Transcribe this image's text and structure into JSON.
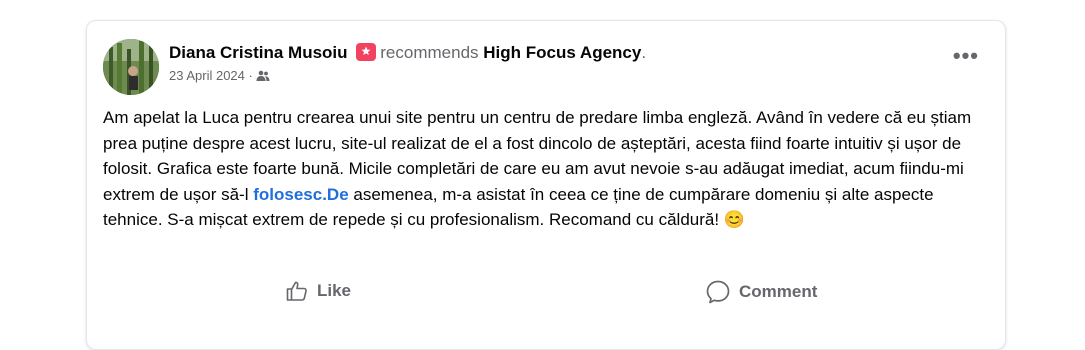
{
  "post": {
    "author": "Diana Cristina Musoiu",
    "recommends_text": "recommends",
    "page_name": "High Focus Agency",
    "period": ".",
    "date": "23 April 2024",
    "date_separator": " · ",
    "audience_icon": "friends-icon",
    "more_label": "•••",
    "text_before_link": "Am apelat la Luca pentru crearea unui site pentru un centru de predare limba engleză. Având în vedere că eu știam prea puține despre acest lucru, site-ul realizat de el a fost dincolo de așteptări, acesta fiind foarte intuitiv și ușor de folosit. Grafica este foarte bună. Micile completări de care eu am avut nevoie s-au adăugat imediat, acum fiindu-mi extrem de ușor să-l ",
    "link_text": "folosesc.De",
    "text_after_link": " asemenea, m-a asistat în ceea ce ține de cumpărare domeniu și alte aspecte tehnice. S-a mișcat extrem de repede și cu profesionalism. Recomand cu căldură! ",
    "emoji": "😊"
  },
  "actions": {
    "like_label": "Like",
    "comment_label": "Comment"
  },
  "colors": {
    "accent_link": "#216fdb",
    "badge": "#f3425f",
    "secondary_text": "#65676b"
  }
}
